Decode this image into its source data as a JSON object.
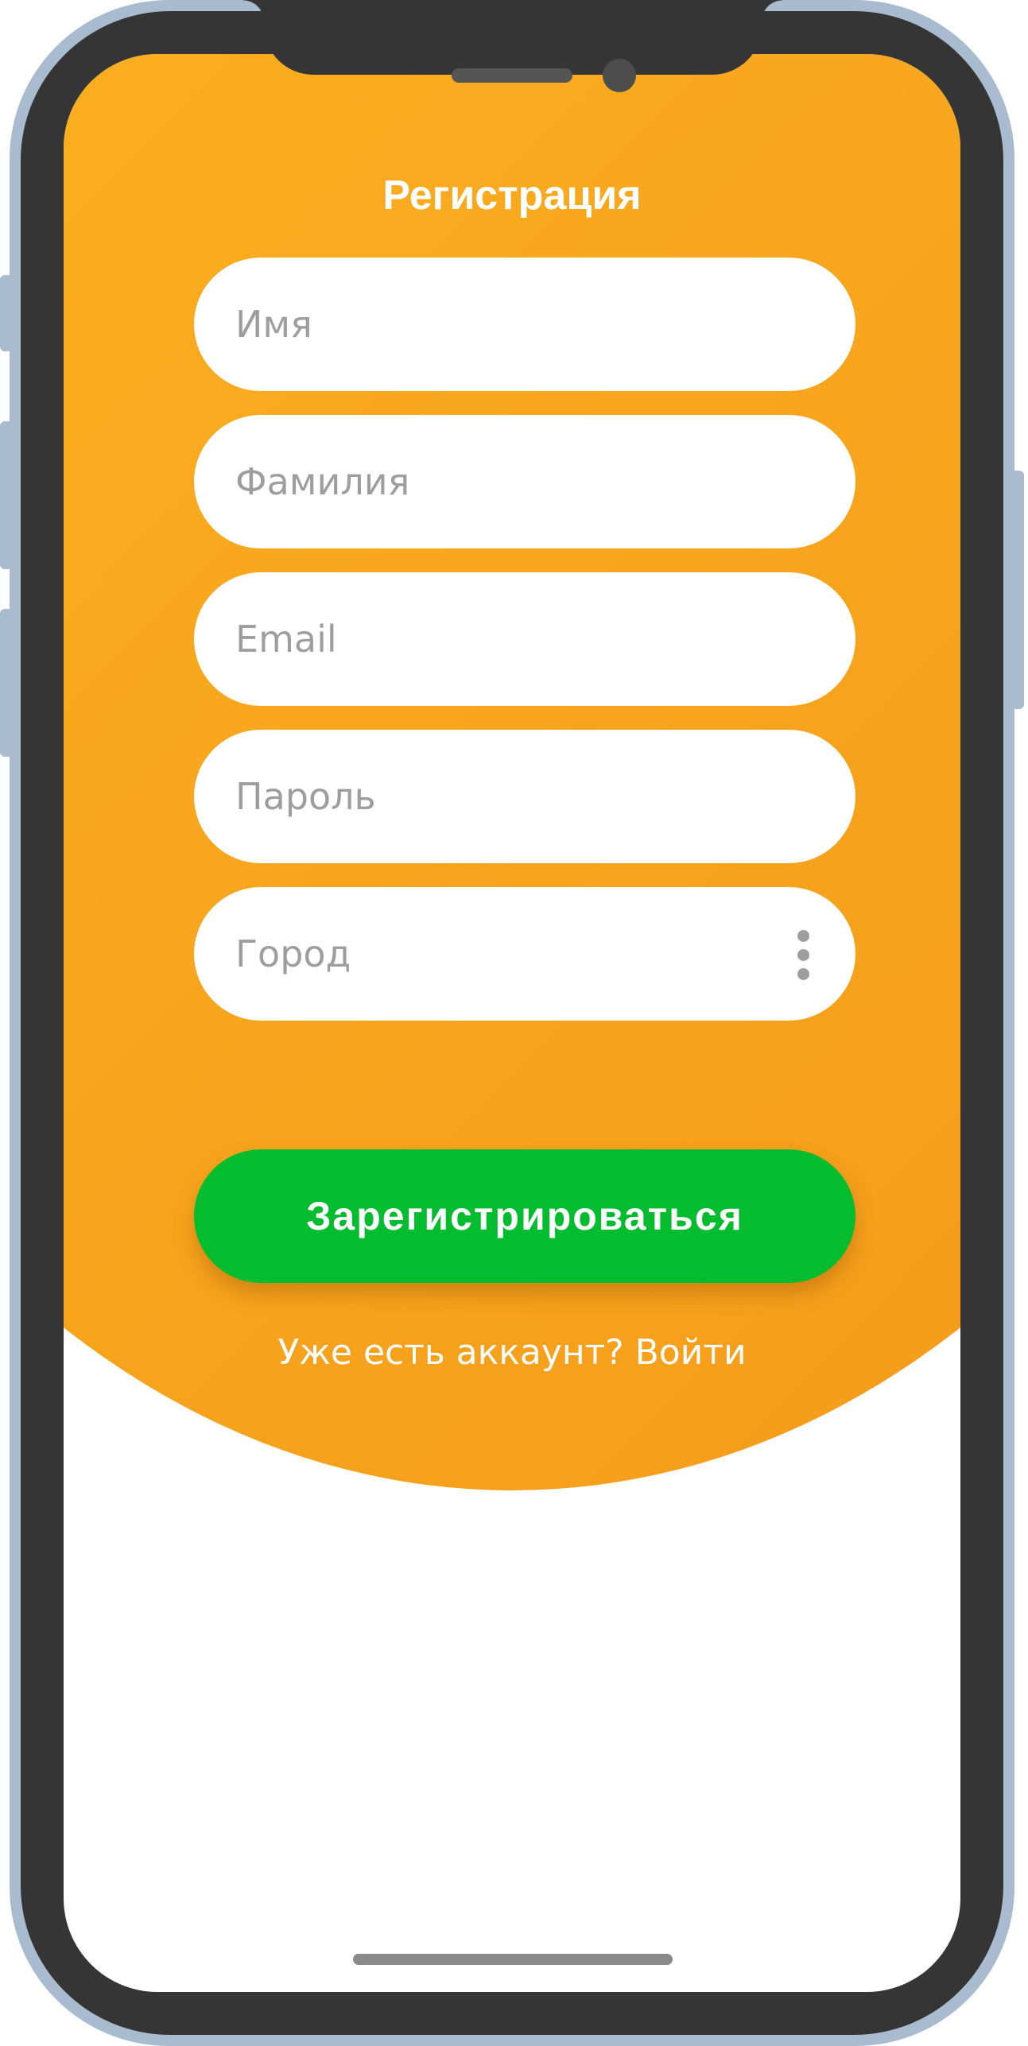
{
  "screen": {
    "title": "Регистрация"
  },
  "form": {
    "fields": [
      {
        "placeholder": "Имя",
        "value": ""
      },
      {
        "placeholder": "Фамилия",
        "value": ""
      },
      {
        "placeholder": "Email",
        "value": ""
      },
      {
        "placeholder": "Пароль",
        "value": ""
      },
      {
        "placeholder": "Город",
        "value": ""
      }
    ],
    "city_menu_icon": "more-vertical-icon",
    "submit_label": "Зарегистрироваться"
  },
  "footer": {
    "login_prompt": "Уже есть аккаунт? Войти"
  },
  "colors": {
    "accent_orange": "#f8a61e",
    "button_green": "#04bd2f",
    "device_frame": "#a9bccf",
    "bezel": "#353535"
  }
}
